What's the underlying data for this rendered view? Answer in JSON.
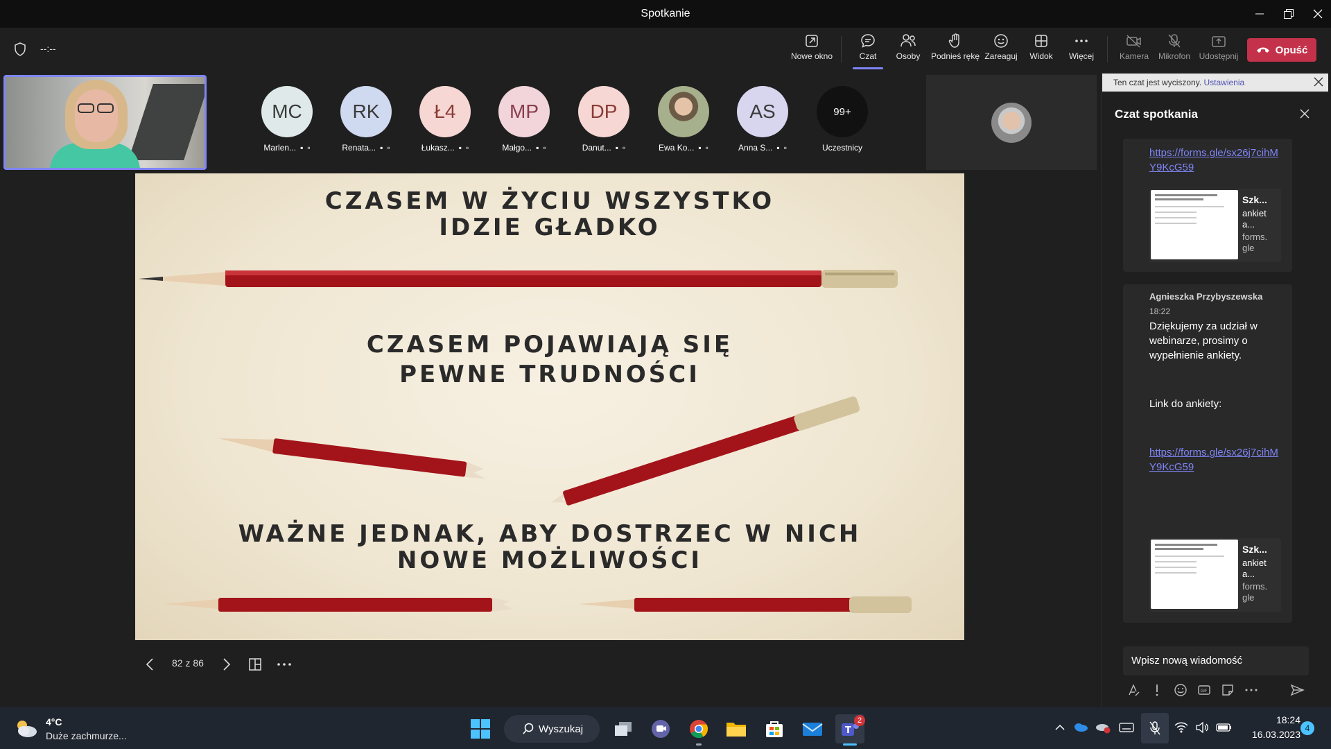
{
  "window": {
    "title": "Spotkanie"
  },
  "meeting": {
    "timer": "--:--"
  },
  "toolbar": {
    "new_window": "Nowe okno",
    "chat": "Czat",
    "people": "Osoby",
    "raise_hand": "Podnieś rękę",
    "react": "Zareaguj",
    "view": "Widok",
    "more": "Więcej",
    "camera": "Kamera",
    "mic": "Mikrofon",
    "share": "Udostępnij",
    "leave": "Opuść"
  },
  "participants": [
    {
      "initials": "MC",
      "name": "Marlen...",
      "color": "#dfe9ea"
    },
    {
      "initials": "RK",
      "name": "Renata...",
      "color": "#cfd9ef"
    },
    {
      "initials": "Ł4",
      "name": "Łukasz...",
      "color": "#f6d7d4"
    },
    {
      "initials": "MP",
      "name": "Małgo...",
      "color": "#f1d5da"
    },
    {
      "initials": "DP",
      "name": "Danut...",
      "color": "#f6d7d4"
    },
    {
      "initials": "",
      "name": "Ewa Ko...",
      "color": "#8a8f7a"
    },
    {
      "initials": "AS",
      "name": "Anna S...",
      "color": "#d8d5ee"
    }
  ],
  "overflow": {
    "count": "99+",
    "label": "Uczestnicy"
  },
  "slide": {
    "line1": "CZASEM W ŻYCIU WSZYSTKO",
    "line2": "IDZIE GŁADKO",
    "line3": "CZASEM POJAWIAJĄ SIĘ",
    "line4": "PEWNE TRUDNOŚCI",
    "line5": "WAŻNE JEDNAK, ABY DOSTRZEC W NICH",
    "line6": "NOWE MOŻLIWOŚCI"
  },
  "slide_nav": {
    "page": "82 z 86"
  },
  "chat": {
    "muted_notice": "Ten czat jest wyciszony.",
    "settings_link": "Ustawienia",
    "title": "Czat spotkania",
    "link1": "https://forms.gle/sx26j7cihMY9KcG59",
    "card1": {
      "title": "Szk...",
      "sub1": "ankiet",
      "sub2": "a...",
      "domain1": "forms.",
      "domain2": "gle"
    },
    "msg": {
      "author": "Agnieszka Przybyszewska",
      "time": "18:22",
      "text1": "Dziękujemy za udział w webinarze, prosimy o wypełnienie ankiety.",
      "text2": "Link do ankiety:",
      "link": "https://forms.gle/sx26j7cihMY9KcG59"
    },
    "card2": {
      "title": "Szk...",
      "sub1": "ankiet",
      "sub2": "a...",
      "domain1": "forms.",
      "domain2": "gle"
    },
    "input_placeholder": "Wpisz nową wiadomość"
  },
  "taskbar": {
    "temp": "4°C",
    "weather": "Duże zachmurze...",
    "search": "Wyszukaj",
    "teams_badge": "2",
    "time": "18:24",
    "date": "16.03.2023",
    "notif": "4"
  }
}
